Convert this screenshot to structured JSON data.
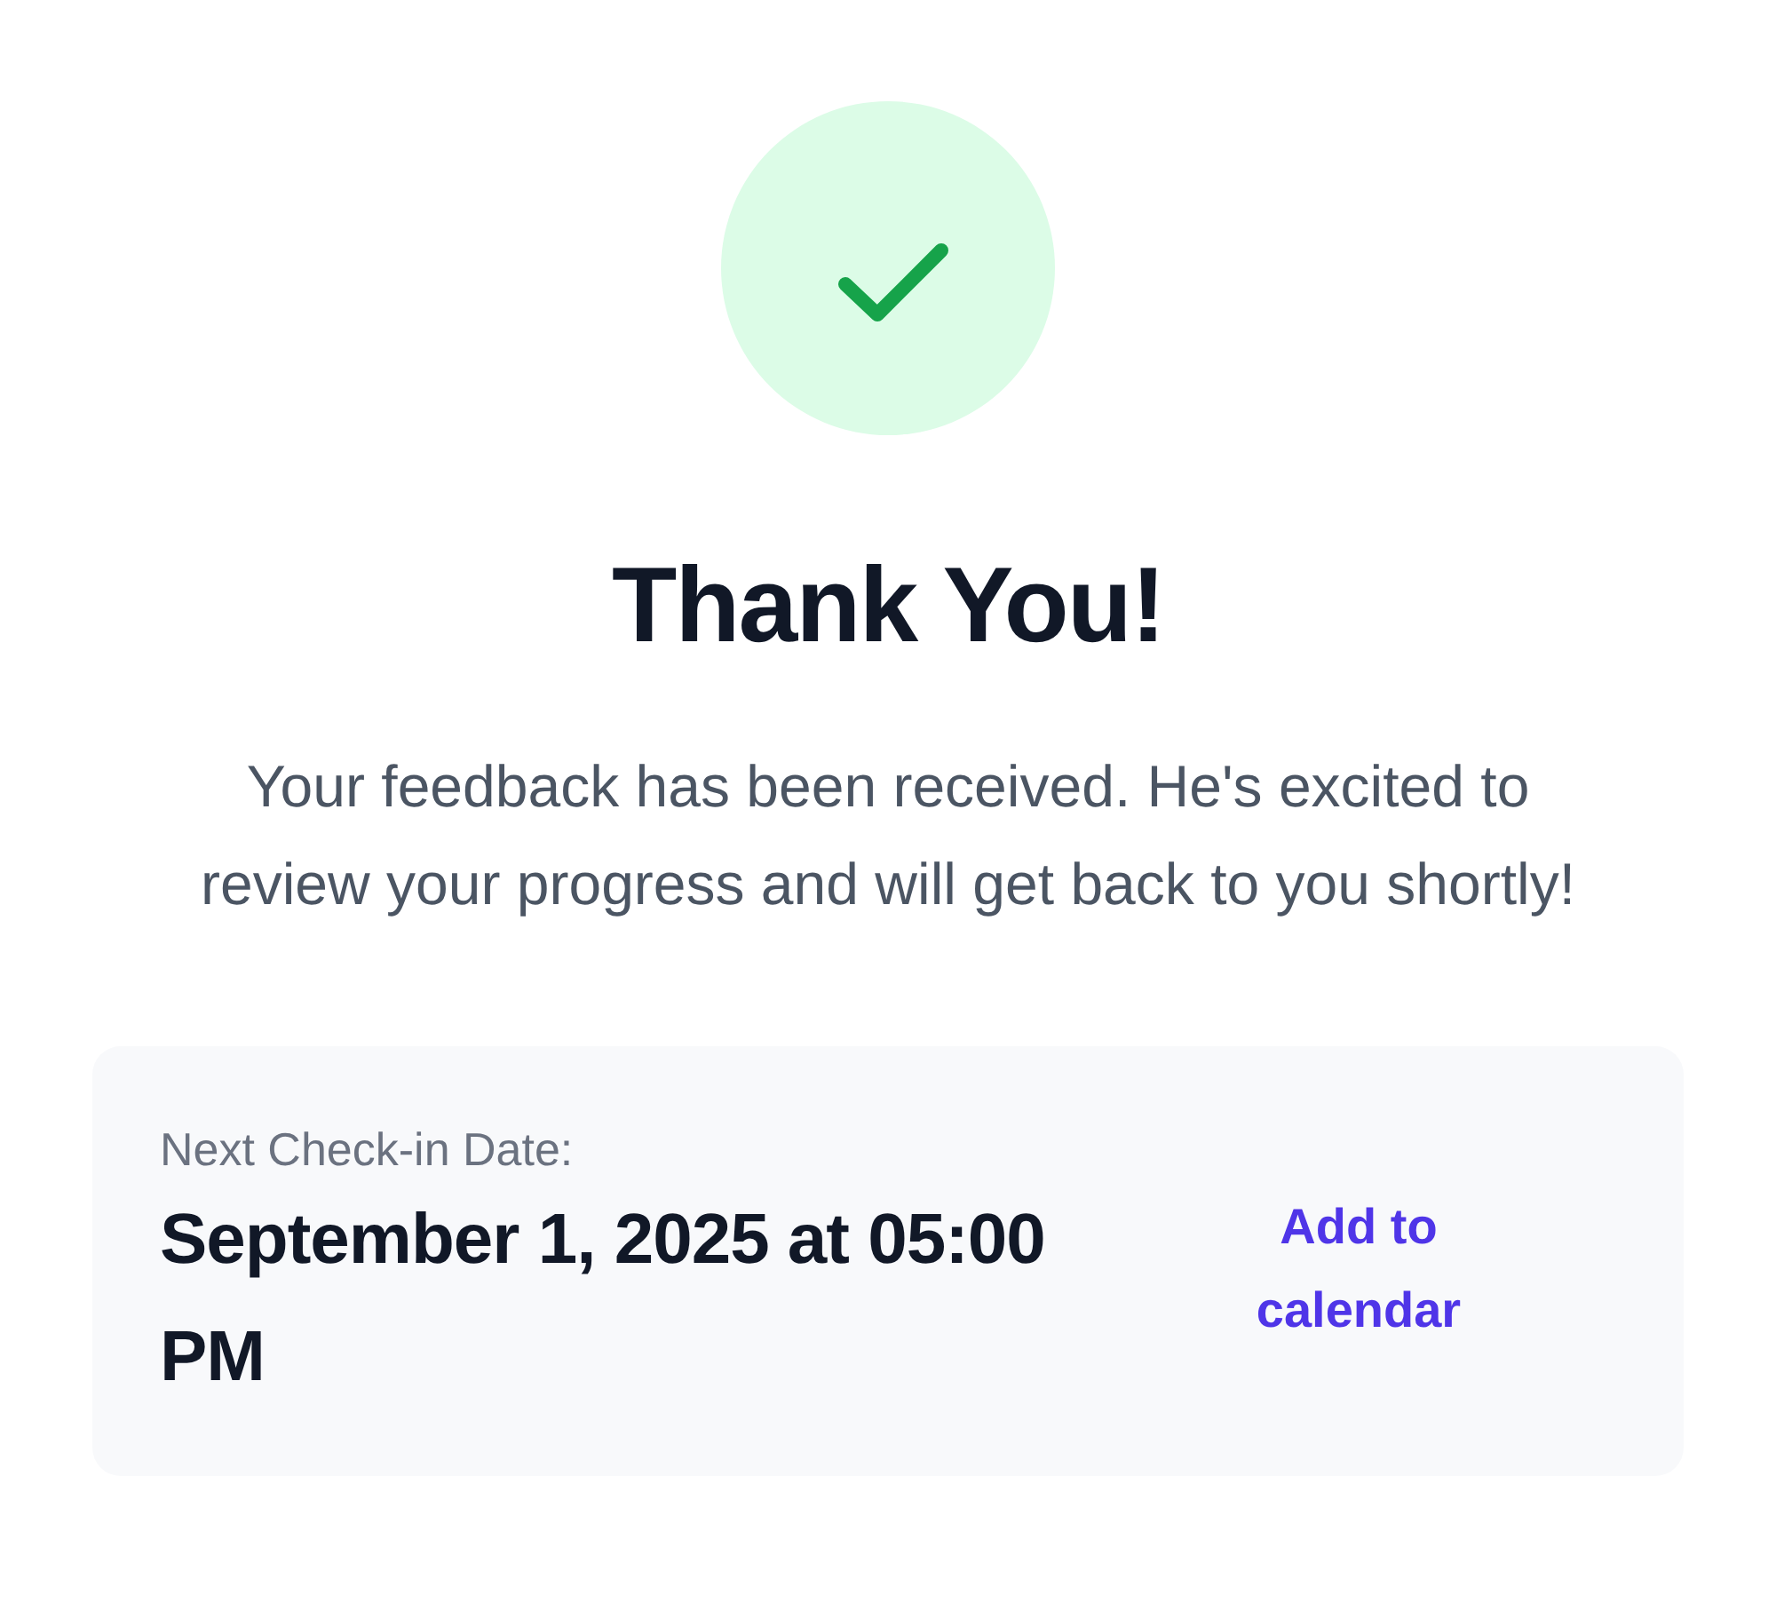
{
  "title": "Thank You!",
  "message": "Your feedback has been received. He's excited to review your progress and will get back to you shortly!",
  "next_checkin": {
    "label": "Next Check-in Date:",
    "date": "September 1, 2025 at 05:00 PM",
    "action": "Add to calendar"
  }
}
